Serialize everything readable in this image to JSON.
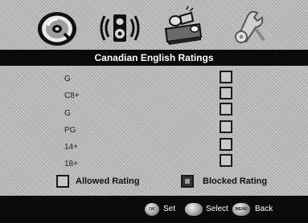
{
  "header": {
    "title": "Canadian English Ratings",
    "menu_icons": [
      {
        "name": "disc-icon"
      },
      {
        "name": "speaker-icon"
      },
      {
        "name": "picture-icon"
      },
      {
        "name": "setup-icon"
      }
    ]
  },
  "ratings": [
    {
      "label": "G",
      "blocked": false
    },
    {
      "label": "C8+",
      "blocked": false
    },
    {
      "label": "G",
      "blocked": false
    },
    {
      "label": "PG",
      "blocked": false
    },
    {
      "label": "14+",
      "blocked": false
    },
    {
      "label": "18+",
      "blocked": false
    }
  ],
  "legend": {
    "allowed_label": "Allowed Rating",
    "blocked_label": "Blocked Rating"
  },
  "footer": {
    "ok_icon_text": "OK",
    "set_label": "Set",
    "select_label": "Select",
    "menu_icon_text": "MENU",
    "back_label": "Back"
  }
}
